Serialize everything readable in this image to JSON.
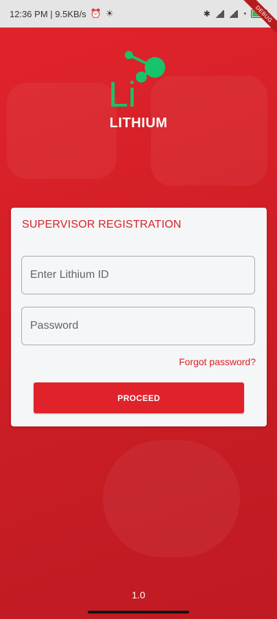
{
  "status_bar": {
    "time_speed": "12:36 PM | 9.5KB/s",
    "debug_label": "DEBUG"
  },
  "brand": {
    "logo_text": "Li",
    "name": "LITHIUM",
    "logo_color": "#17c46a"
  },
  "form": {
    "title": "SUPERVISOR REGISTRATION",
    "lithium_id": {
      "placeholder": "Enter Lithium ID",
      "value": ""
    },
    "password": {
      "placeholder": "Password",
      "value": ""
    },
    "forgot_label": "Forgot password?",
    "proceed_label": "PROCEED"
  },
  "footer": {
    "version": "1.0"
  },
  "colors": {
    "primary": "#e0232b",
    "accent_text": "#d81f26"
  }
}
